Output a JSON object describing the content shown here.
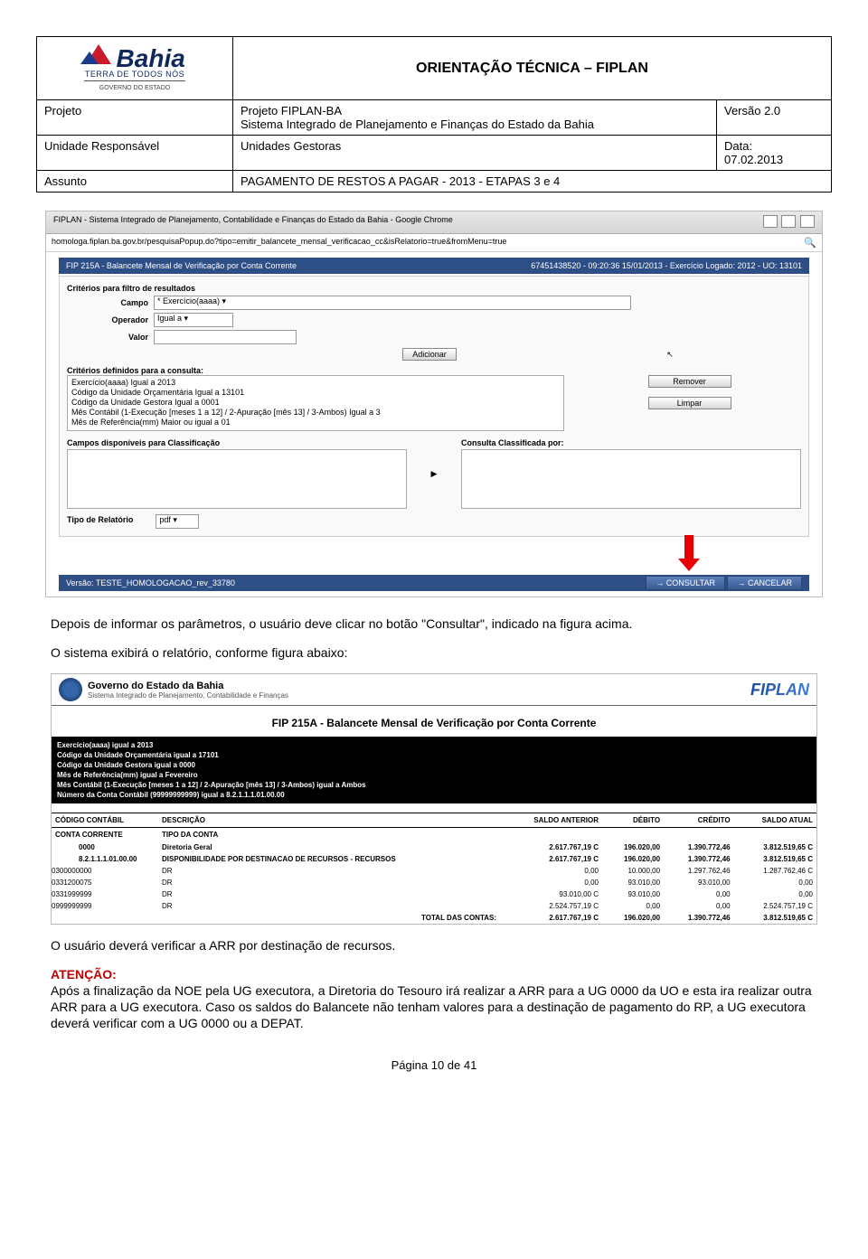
{
  "doc": {
    "title": "ORIENTAÇÃO TÉCNICA – FIPLAN",
    "logo_name": "Bahia",
    "logo_tagline": "TERRA DE TODOS NÓS",
    "logo_gov": "GOVERNO DO ESTADO",
    "row1": {
      "label": "Projeto",
      "value": "Projeto FIPLAN-BA\nSistema Integrado de Planejamento e Finanças do Estado da Bahia",
      "ver_label": "Versão 2.0"
    },
    "row2": {
      "label": "Unidade Responsável",
      "value": "Unidades Gestoras",
      "ver_label": "Data:\n07.02.2013"
    },
    "row3": {
      "label": "Assunto",
      "value": "PAGAMENTO DE RESTOS A PAGAR - 2013 - ETAPAS 3 e 4"
    }
  },
  "shot1": {
    "window_title": "FIPLAN - Sistema Integrado de Planejamento, Contabilidade e Finanças do Estado da Bahia - Google Chrome",
    "url": "homologa.fiplan.ba.gov.br/pesquisaPopup.do?tipo=emitir_balancete_mensal_verificacao_cc&isRelatorio=true&fromMenu=true",
    "panel_title": "FIP 215A - Balancete Mensal de Verificação por Conta Corrente",
    "panel_info": "67451438520 - 09:20:36 15/01/2013 - Exercício Logado: 2012 - UO: 13101",
    "criterios_label": "Critérios para filtro de resultados",
    "campo_label": "Campo",
    "campo_value": "Exercício(aaaa)",
    "operador_label": "Operador",
    "operador_value": "Igual a",
    "valor_label": "Valor",
    "adicionar_btn": "Adicionar",
    "definidos_label": "Critérios definidos para a consulta:",
    "definidos_lines": "Exercício(aaaa) Igual a 2013\nCódigo da Unidade Orçamentária Igual a 13101\nCódigo da Unidade Gestora Igual a 0001\nMês Contábil (1-Execução [meses 1 a 12] / 2-Apuração [mês 13] / 3-Ambos) Igual a 3\nMês de Referência(mm) Maior ou igual a 01",
    "remover_btn": "Remover",
    "limpar_btn": "Limpar",
    "disp_label": "Campos disponíveis para Classificação",
    "class_label": "Consulta Classificada por:",
    "tipo_label": "Tipo de Relatório",
    "tipo_value": "pdf",
    "versao": "Versão: TESTE_HOMOLOGACAO_rev_33780",
    "consultar_btn": "→ CONSULTAR",
    "cancelar_btn": "→ CANCELAR"
  },
  "text1": "Depois de informar os parâmetros, o usuário deve clicar no botão \"Consultar\", indicado na figura acima.",
  "text2": "O sistema exibirá o relatório, conforme figura abaixo:",
  "shot2": {
    "gov_title": "Governo do Estado da Bahia",
    "gov_sub": "Sistema Integrado de Planejamento, Contabilidade e Finanças",
    "fiplan": "FIPLAN",
    "rep_title": "FIP 215A - Balancete Mensal de Verificação por Conta Corrente",
    "params": "Exercício(aaaa) igual a 2013\nCódigo da Unidade Orçamentária igual a 17101\nCódigo da Unidade Gestora igual a 0000\nMês de Referência(mm) igual a Fevereiro\nMês Contábil (1-Execução [meses 1 a 12] / 2-Apuração [mês 13] / 3-Ambos) igual a Ambos\nNúmero da Conta Contábil (99999999999) igual a 8.2.1.1.1.01.00.00",
    "headers": [
      "CÓDIGO CONTÁBIL",
      "DESCRIÇÃO",
      "SALDO ANTERIOR",
      "DÉBITO",
      "CRÉDITO",
      "SALDO ATUAL"
    ],
    "sub_headers": [
      "CONTA CORRENTE",
      "TIPO DA CONTA"
    ],
    "rows": [
      {
        "cc": "",
        "conta": "0000",
        "desc": "Diretoria Geral",
        "sa": "2.617.767,19 C",
        "deb": "196.020,00",
        "cre": "1.390.772,46",
        "satu": "3.812.519,65 C",
        "bold": true
      },
      {
        "cc": "",
        "conta": "8.2.1.1.1.01.00.00",
        "desc": "DISPONIBILIDADE POR DESTINACAO DE RECURSOS - RECURSOS",
        "sa": "2.617.767,19 C",
        "deb": "196.020,00",
        "cre": "1.390.772,46",
        "satu": "3.812.519,65 C",
        "bold": true
      },
      {
        "cc": "0300000000",
        "conta": "",
        "desc": "DR",
        "sa": "0,00",
        "deb": "10.000,00",
        "cre": "1.297.762,46",
        "satu": "1.287.762,46 C",
        "bold": false
      },
      {
        "cc": "0331200075",
        "conta": "",
        "desc": "DR",
        "sa": "0,00",
        "deb": "93.010,00",
        "cre": "93.010,00",
        "satu": "0,00",
        "bold": false
      },
      {
        "cc": "0331999999",
        "conta": "",
        "desc": "DR",
        "sa": "93.010,00 C",
        "deb": "93.010,00",
        "cre": "0,00",
        "satu": "0,00",
        "bold": false
      },
      {
        "cc": "0999999999",
        "conta": "",
        "desc": "DR",
        "sa": "2.524.757,19 C",
        "deb": "0,00",
        "cre": "0,00",
        "satu": "2.524.757,19 C",
        "bold": false
      }
    ],
    "total_label": "TOTAL DAS CONTAS:",
    "total": {
      "sa": "2.617.767,19 C",
      "deb": "196.020,00",
      "cre": "1.390.772,46",
      "satu": "3.812.519,65 C"
    }
  },
  "text3": "O usuário deverá verificar a ARR por destinação de recursos.",
  "atencao_label": "ATENÇÃO:",
  "text4": "Após a finalização da NOE pela UG executora, a Diretoria do Tesouro irá realizar a ARR para a UG 0000 da UO e esta ira realizar outra ARR para a UG executora. Caso os saldos do Balancete não tenham valores para a destinação de pagamento do RP, a UG executora deverá verificar com a UG 0000 ou a DEPAT.",
  "pager": "Página 10 de 41"
}
